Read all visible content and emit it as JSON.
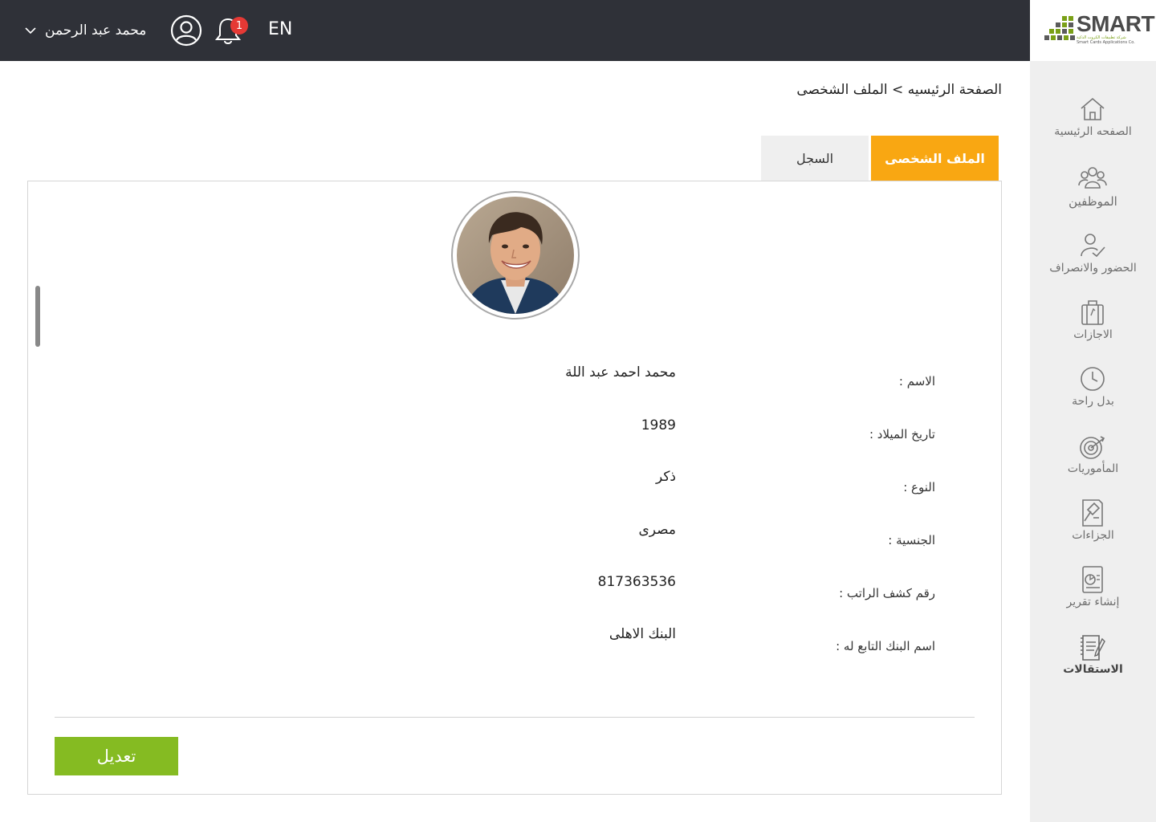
{
  "topbar": {
    "user_name": "محمد عبد الرحمن",
    "notification_count": "1",
    "language": "EN"
  },
  "logo": {
    "brand": "SMART",
    "arabic_name": "شركة تطبيقات الكروت الذكية",
    "english_name": "Smart Cards Applications Co."
  },
  "sidebar": {
    "items": [
      {
        "label": "الصفحه الرئيسية",
        "icon": "home-icon"
      },
      {
        "label": "الموظفين",
        "icon": "employees-icon"
      },
      {
        "label": "الحضور والانصراف",
        "icon": "attendance-icon"
      },
      {
        "label": "الاجازات",
        "icon": "vacation-icon"
      },
      {
        "label": "بدل راحة",
        "icon": "clock-icon"
      },
      {
        "label": "المأموريات",
        "icon": "target-icon"
      },
      {
        "label": "الجزاءات",
        "icon": "gavel-icon"
      },
      {
        "label": "إنشاء تقرير",
        "icon": "report-icon"
      },
      {
        "label": "الاستقالات",
        "icon": "resignation-icon"
      }
    ]
  },
  "breadcrumb": "الصفحة الرئيسيه > الملف الشخصى",
  "tabs": {
    "profile": "الملف الشخصى",
    "log": "السجل"
  },
  "profile": {
    "fields": [
      {
        "label": "الاسم :",
        "value": "محمد احمد عبد اللة"
      },
      {
        "label": "تاريخ الميلاد :",
        "value": "1989"
      },
      {
        "label": "النوع :",
        "value": "ذكر"
      },
      {
        "label": "الجنسية :",
        "value": "مصرى"
      },
      {
        "label": "رقم كشف الراتب :",
        "value": "817363536"
      },
      {
        "label": "اسم البنك التابع له :",
        "value": "البنك الاهلى"
      }
    ],
    "edit_button": "تعديل"
  },
  "colors": {
    "topbar": "#2f3138",
    "accent_tab": "#f9a712",
    "edit_button": "#85bb22",
    "badge": "#e53935",
    "sidebar": "#efefef"
  }
}
